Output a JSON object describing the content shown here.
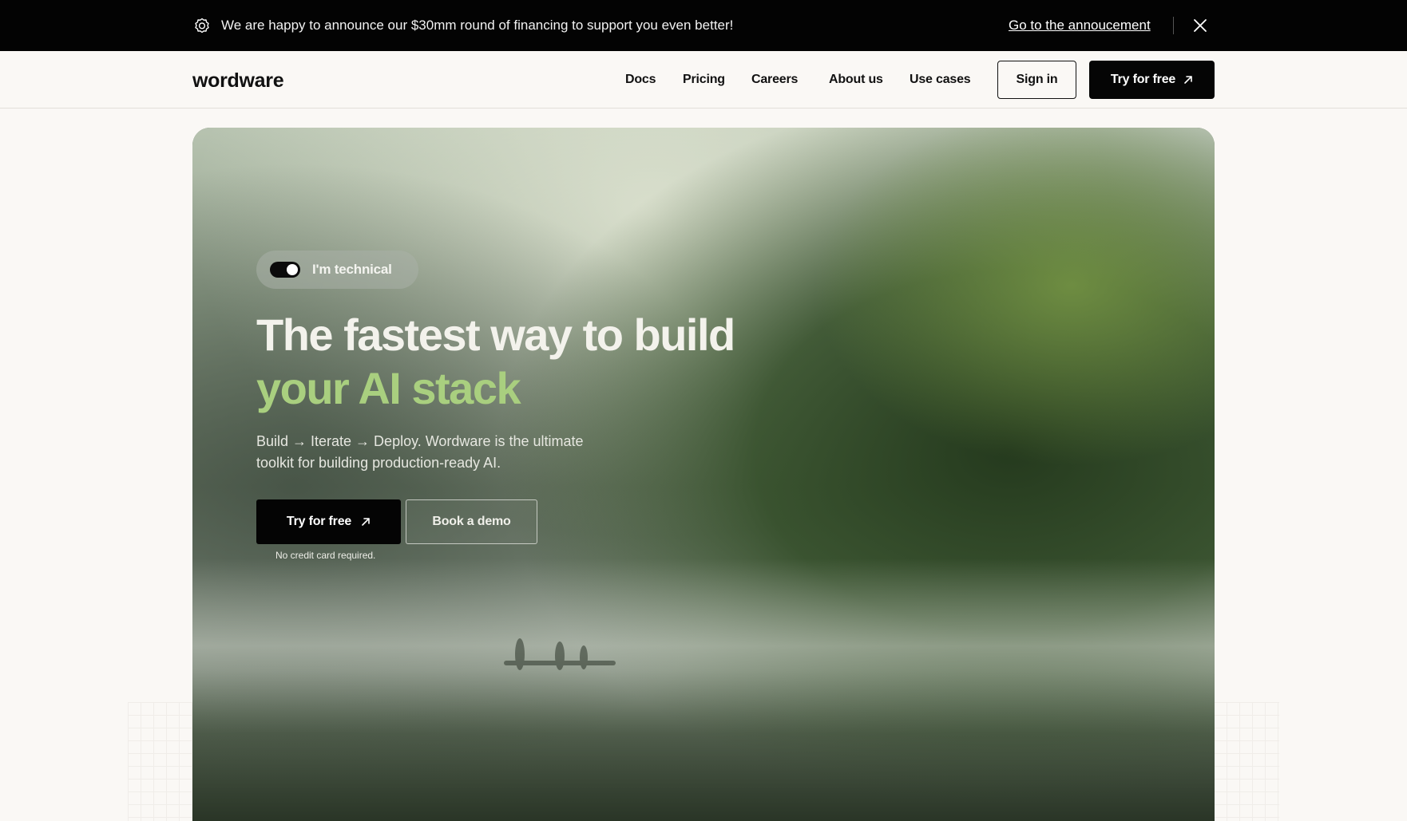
{
  "announcement": {
    "text": "We are happy to announce our $30mm round of financing to support you even better!",
    "link_label": "Go to the annoucement",
    "icon": "badge-icon",
    "close_icon": "close-icon"
  },
  "nav": {
    "logo": "wordware",
    "links": [
      {
        "label": "Docs"
      },
      {
        "label": "Pricing"
      },
      {
        "label": "Careers"
      },
      {
        "label": "About us"
      },
      {
        "label": "Use cases"
      }
    ],
    "sign_in_label": "Sign in",
    "try_label": "Try for free"
  },
  "hero": {
    "toggle_label": "I'm technical",
    "toggle_on": true,
    "headline_part1": "The fastest way to build ",
    "headline_accent": "your AI stack",
    "subtext": "Build → Iterate → Deploy. Wordware is the ultimate toolkit for building production-ready AI.",
    "try_label": "Try for free",
    "demo_label": "Book a demo",
    "no_card_note": "No credit card required."
  },
  "colors": {
    "accent": "#a9cf7f",
    "bar": "#030303",
    "page_bg": "#faf8f5"
  }
}
